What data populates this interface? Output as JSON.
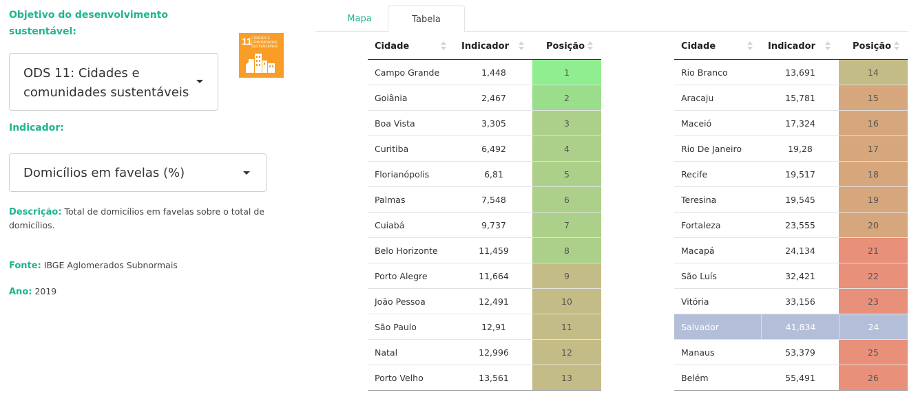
{
  "sidebar": {
    "objective_label": "Objetivo do desenvolvimento sustentável:",
    "objective_selected": "ODS 11: Cidades e comunidades sustentáveis",
    "sdg_logo": {
      "number": "11",
      "text": "CIDADES E COMUNIDADES SUSTENTÁVEIS",
      "color": "#f99d26"
    },
    "indicator_label": "Indicador:",
    "indicator_selected": "Domicílios em favelas (%)",
    "description_label": "Descrição:",
    "description_text": "Total de domicílios em favelas sobre o total de domicílios.",
    "source_label": "Fonte:",
    "source_text": "IBGE Aglomerados Subnormais",
    "year_label": "Ano:",
    "year_text": "2019"
  },
  "tabs": [
    {
      "label": "Mapa",
      "active": false
    },
    {
      "label": "Tabela",
      "active": true
    }
  ],
  "table": {
    "columns": [
      "Cidade",
      "Indicador",
      "Posição"
    ],
    "highlight_color": "#b3bfd8",
    "left": [
      {
        "city": "Campo Grande",
        "value": "1,448",
        "pos": "1",
        "color": "#90ee90"
      },
      {
        "city": "Goiânia",
        "value": "2,467",
        "pos": "2",
        "color": "#9ade8b"
      },
      {
        "city": "Boa Vista",
        "value": "3,305",
        "pos": "3",
        "color": "#acd08a"
      },
      {
        "city": "Curitiba",
        "value": "6,492",
        "pos": "4",
        "color": "#acd08a"
      },
      {
        "city": "Florianópolis",
        "value": "6,81",
        "pos": "5",
        "color": "#acd08a"
      },
      {
        "city": "Palmas",
        "value": "7,548",
        "pos": "6",
        "color": "#acd08a"
      },
      {
        "city": "Cuiabá",
        "value": "9,737",
        "pos": "7",
        "color": "#acd08a"
      },
      {
        "city": "Belo Horizonte",
        "value": "11,459",
        "pos": "8",
        "color": "#acd08a"
      },
      {
        "city": "Porto Alegre",
        "value": "11,664",
        "pos": "9",
        "color": "#c4bc87"
      },
      {
        "city": "João Pessoa",
        "value": "12,491",
        "pos": "10",
        "color": "#c4bc87"
      },
      {
        "city": "São Paulo",
        "value": "12,91",
        "pos": "11",
        "color": "#c4bc87"
      },
      {
        "city": "Natal",
        "value": "12,996",
        "pos": "12",
        "color": "#c4bc87"
      },
      {
        "city": "Porto Velho",
        "value": "13,561",
        "pos": "13",
        "color": "#c4bc87"
      }
    ],
    "right": [
      {
        "city": "Rio Branco",
        "value": "13,691",
        "pos": "14",
        "color": "#c4bc87"
      },
      {
        "city": "Aracaju",
        "value": "15,781",
        "pos": "15",
        "color": "#d6a67c"
      },
      {
        "city": "Maceió",
        "value": "17,324",
        "pos": "16",
        "color": "#d6a67c"
      },
      {
        "city": "Rio De Janeiro",
        "value": "19,28",
        "pos": "17",
        "color": "#d6a67c"
      },
      {
        "city": "Recife",
        "value": "19,517",
        "pos": "18",
        "color": "#d6a67c"
      },
      {
        "city": "Teresina",
        "value": "19,545",
        "pos": "19",
        "color": "#d6a67c"
      },
      {
        "city": "Fortaleza",
        "value": "23,555",
        "pos": "20",
        "color": "#d6a67c"
      },
      {
        "city": "Macapá",
        "value": "24,134",
        "pos": "21",
        "color": "#e8907a"
      },
      {
        "city": "São Luís",
        "value": "32,421",
        "pos": "22",
        "color": "#e8907a"
      },
      {
        "city": "Vitória",
        "value": "33,156",
        "pos": "23",
        "color": "#e8907a"
      },
      {
        "city": "Salvador",
        "value": "41,834",
        "pos": "24",
        "color": "#b3bfd8",
        "highlight": true
      },
      {
        "city": "Manaus",
        "value": "53,379",
        "pos": "25",
        "color": "#e8907a"
      },
      {
        "city": "Belém",
        "value": "55,491",
        "pos": "26",
        "color": "#e8907a"
      }
    ]
  }
}
